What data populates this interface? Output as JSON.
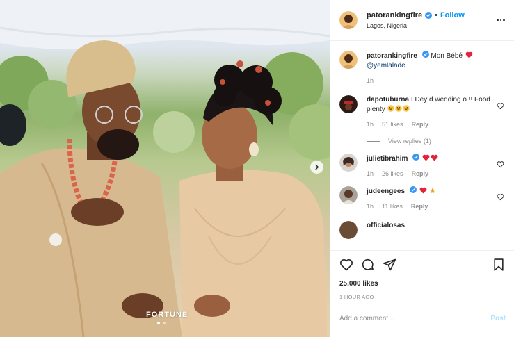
{
  "header": {
    "username": "patorankingfire",
    "follow_label": "Follow",
    "separator": "•",
    "location": "Lagos, Nigeria"
  },
  "photo": {
    "watermark": "FORTUNE",
    "carousel_dots": 2,
    "active_dot": 1
  },
  "caption": {
    "username": "patorankingfire",
    "text": "Mon Bébé",
    "mention": "@yemlalade",
    "time": "1h"
  },
  "comments": [
    {
      "username": "dapotuburna",
      "text": "I Dey d wedding o !! Food plenty",
      "time": "1h",
      "likes": "51 likes",
      "reply": "Reply",
      "verified": false
    },
    {
      "username": "julietibrahim",
      "text": "",
      "time": "1h",
      "likes": "26 likes",
      "reply": "Reply",
      "verified": true
    },
    {
      "username": "judeengees",
      "text": "",
      "time": "1h",
      "likes": "11 likes",
      "reply": "Reply",
      "verified": true
    }
  ],
  "view_replies": "View replies (1)",
  "partial_comment": "officialosas",
  "likes_count": "25,000 likes",
  "post_time": "1 HOUR AGO",
  "add_comment": {
    "placeholder": "Add a comment...",
    "post_label": "Post"
  },
  "colors": {
    "link_blue": "#0095f6",
    "verified_blue": "#3897f0",
    "heart_red": "#ed4956",
    "muted": "#8e8e8e"
  },
  "icons": [
    "more-icon",
    "verified-icon",
    "heart-icon",
    "comment-icon",
    "share-icon",
    "bookmark-icon",
    "chevron-right-icon"
  ]
}
